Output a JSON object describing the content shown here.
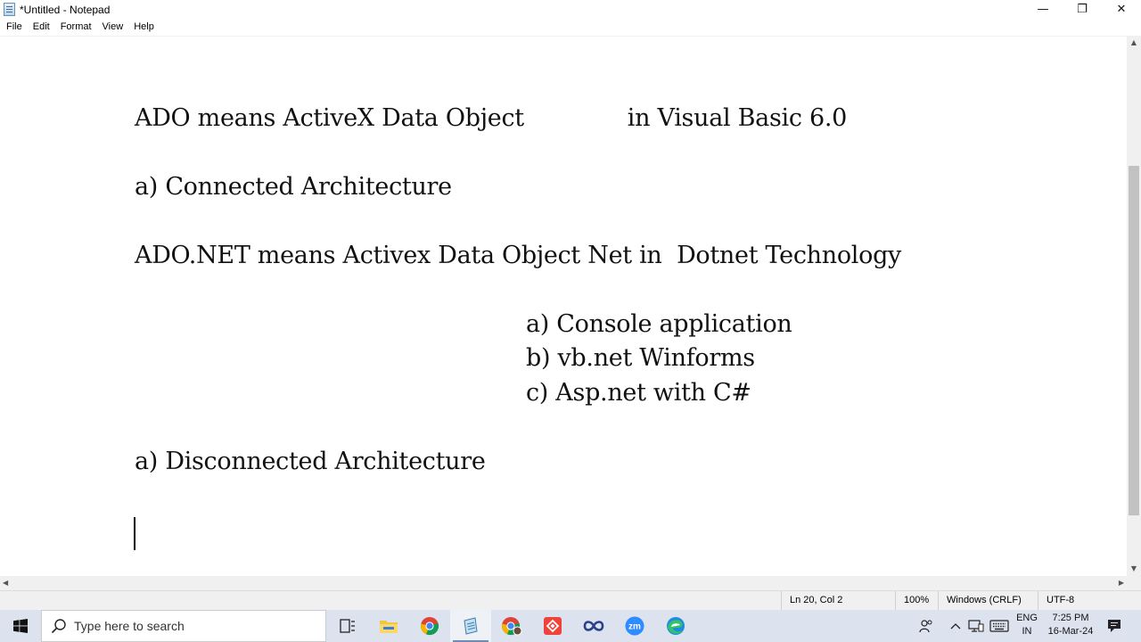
{
  "window": {
    "title": "*Untitled - Notepad",
    "minimize_glyph": "—",
    "maximize_glyph": "❐",
    "close_glyph": "✕"
  },
  "menu": {
    "items": [
      {
        "label": "File"
      },
      {
        "label": "Edit"
      },
      {
        "label": "Format"
      },
      {
        "label": "View"
      },
      {
        "label": "Help"
      }
    ]
  },
  "editor": {
    "lines": [
      {
        "text": "ADO means ActiveX Data Object              in Visual Basic 6.0"
      },
      {
        "text": "a) Connected Architecture"
      },
      {
        "text": "ADO.NET means Activex Data Object Net in  Dotnet Technology"
      },
      {
        "text": "                                                     a) Console application"
      },
      {
        "text": "                                                     b) vb.net Winforms"
      },
      {
        "text": "                                                     c) Asp.net with C#"
      },
      {
        "text": "a) Disconnected Architecture"
      }
    ]
  },
  "status": {
    "position": "Ln 20, Col 2",
    "zoom": "100%",
    "line_ending": "Windows (CRLF)",
    "encoding": "UTF-8"
  },
  "taskbar": {
    "search_placeholder": "Type here to search",
    "apps": [
      {
        "icon": "task-view-icon"
      },
      {
        "icon": "file-explorer-icon"
      },
      {
        "icon": "chrome-icon"
      },
      {
        "icon": "notepad-icon"
      },
      {
        "icon": "chrome-profile-icon"
      },
      {
        "icon": "anydesk-icon"
      },
      {
        "icon": "infinity-app-icon"
      },
      {
        "icon": "zoom-icon"
      },
      {
        "icon": "edge-icon"
      }
    ],
    "zoom_label": "zm",
    "tray": {
      "lang_primary": "ENG",
      "lang_secondary": "IN",
      "time": "7:25 PM",
      "date": "16-Mar-24"
    }
  },
  "colors": {
    "accent": "#0078d7",
    "taskbar_bg": "#dde3ee"
  }
}
